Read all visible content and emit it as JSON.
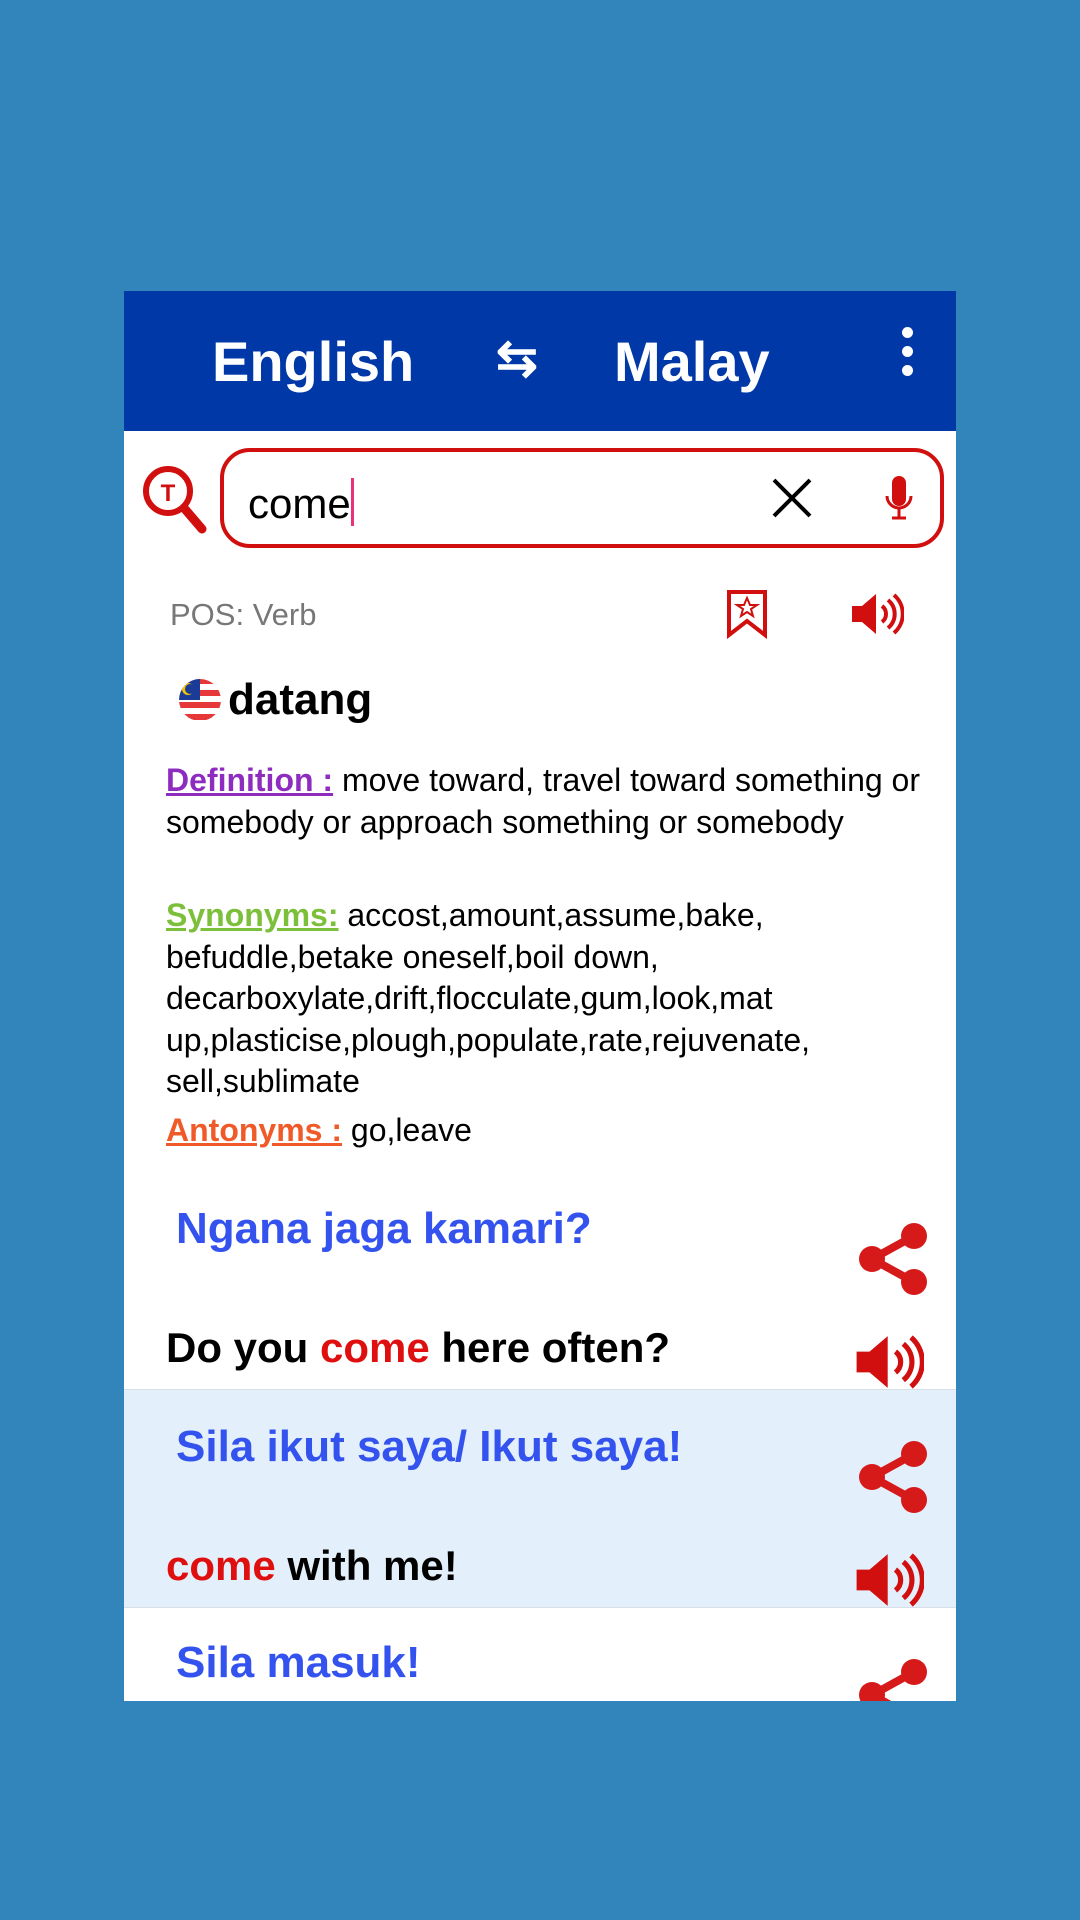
{
  "header": {
    "source_lang": "English",
    "swap_icon": "swap-arrows-icon",
    "target_lang": "Malay",
    "menu_icon": "more-vertical-icon"
  },
  "search": {
    "value": "come",
    "clear_icon": "close-icon",
    "mic_icon": "microphone-icon",
    "translate_icon": "translate-search-icon"
  },
  "result": {
    "pos": "POS: Verb",
    "word": "datang",
    "flag": "malaysia-flag-icon",
    "definition_label": "Definition :",
    "definition": " move toward, travel toward something or somebody or approach something or somebody",
    "synonyms_label": "Synonyms:",
    "synonyms": " accost,amount,assume,bake, befuddle,betake oneself,boil down, decarboxylate,drift,flocculate,gum,look,mat up,plasticise,plough,populate,rate,rejuvenate, sell,sublimate",
    "antonyms_label": "Antonyms :",
    "antonyms": " go,leave"
  },
  "colors": {
    "header": "#0038a8",
    "accent": "#d10f0f",
    "definition": "#8e2cbf",
    "synonyms": "#7cbf3a",
    "antonyms": "#f05a28",
    "translation": "#3352ee",
    "highlight_row": "#e3f0fb"
  },
  "examples": [
    {
      "translation": "Ngana jaga kamari?",
      "pre": "Do you ",
      "hl": "come",
      "post": " here often?"
    },
    {
      "translation": "Sila ikut saya/ Ikut saya!",
      "pre": "",
      "hl": "come",
      "post": " with me!"
    },
    {
      "translation": "Sila masuk!",
      "pre": "",
      "hl": "",
      "post": ""
    }
  ]
}
